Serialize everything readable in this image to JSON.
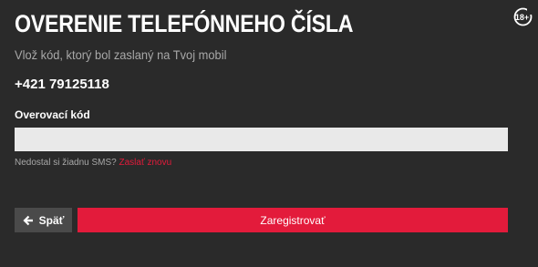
{
  "page": {
    "title": "OVERENIE TELEFÓNNEHO ČÍSLA",
    "subtitle": "Vlož kód, ktorý bol zaslaný na Tvoj mobil",
    "phone_number": "+421 79125118",
    "age_badge": "18+"
  },
  "form": {
    "code_label": "Overovací kód",
    "code_value": "",
    "code_placeholder": "",
    "resend_prefix": "Nedostal si žiadnu SMS?",
    "resend_link": "Zaslať znovu"
  },
  "actions": {
    "back_label": "Späť",
    "back_icon": "arrow-left-icon",
    "register_label": "Zaregistrovať"
  },
  "colors": {
    "background": "#2a2a2a",
    "accent": "#e31b3b",
    "input_bg": "#e9e9e9",
    "muted_text": "#a8a8a8",
    "secondary_button": "#4a4a4a"
  }
}
